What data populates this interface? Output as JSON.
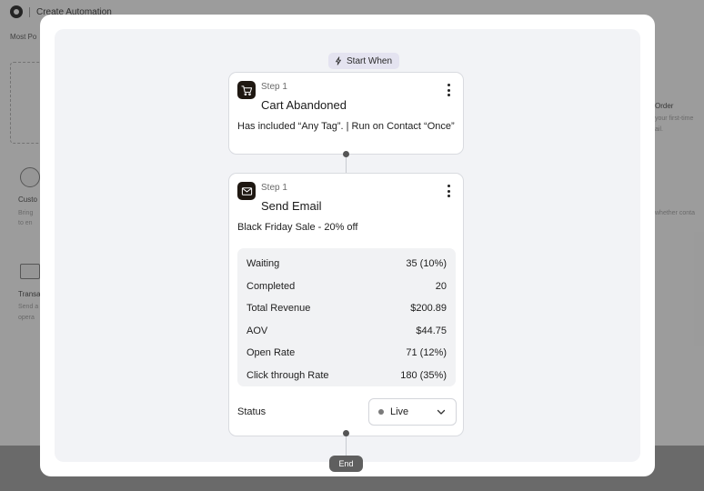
{
  "background": {
    "breadcrumb": "Create Automation",
    "section_title": "Most Po",
    "item1_title": "Custo",
    "item1_desc_line1": "Bring",
    "item1_desc_line2": "to en",
    "item2_title": "Transa",
    "item2_desc_line1": "Send a",
    "item2_desc_line2": "opera",
    "right_title": "Order",
    "right_desc_line1": "your first-time",
    "right_desc_line2": "ail.",
    "right_desc_line3": "whether conta"
  },
  "flow": {
    "start_label": "Start When",
    "end_label": "End",
    "steps": [
      {
        "step_label": "Step 1",
        "title": "Cart Abandoned",
        "description": "Has included “Any Tag”.  | Run on Contact “Once”",
        "icon": "cart-icon"
      },
      {
        "step_label": "Step 1",
        "title": "Send Email",
        "description": "Black Friday Sale - 20% off",
        "icon": "mail-icon",
        "stats": [
          {
            "label": "Waiting",
            "value": "35 (10%)"
          },
          {
            "label": "Completed",
            "value": "20"
          },
          {
            "label": "Total Revenue",
            "value": "$200.89"
          },
          {
            "label": "AOV",
            "value": "$44.75"
          },
          {
            "label": "Open Rate",
            "value": "71 (12%)"
          },
          {
            "label": "Click through Rate",
            "value": "180 (35%)"
          }
        ],
        "status_label": "Status",
        "status_value": "Live"
      }
    ]
  },
  "colors": {
    "icon_bg": "#1f1812",
    "start_pill_bg": "#e4e3f0",
    "end_pill_bg": "#5f5f5f",
    "canvas_bg": "#f2f3f6"
  }
}
